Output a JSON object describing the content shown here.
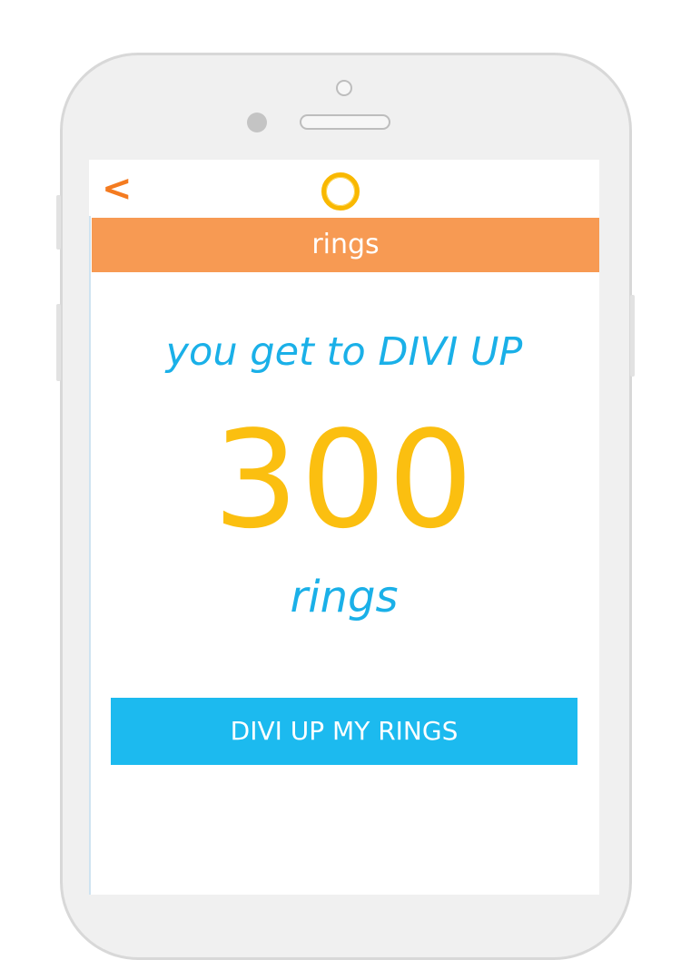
{
  "header": {
    "back_symbol": "<",
    "logo_icon": "ring-icon",
    "title": "rings"
  },
  "main": {
    "tagline": "you get to DIVI UP",
    "count": "300",
    "unit": "rings"
  },
  "action": {
    "button_label": "DIVI UP MY RINGS"
  },
  "colors": {
    "accent_orange": "#f47b20",
    "title_bar": "#f79a53",
    "text_blue": "#1ab0e8",
    "count_yellow": "#fbbf10",
    "button_blue": "#1cbaef",
    "ring_gold": "#f9b800"
  }
}
